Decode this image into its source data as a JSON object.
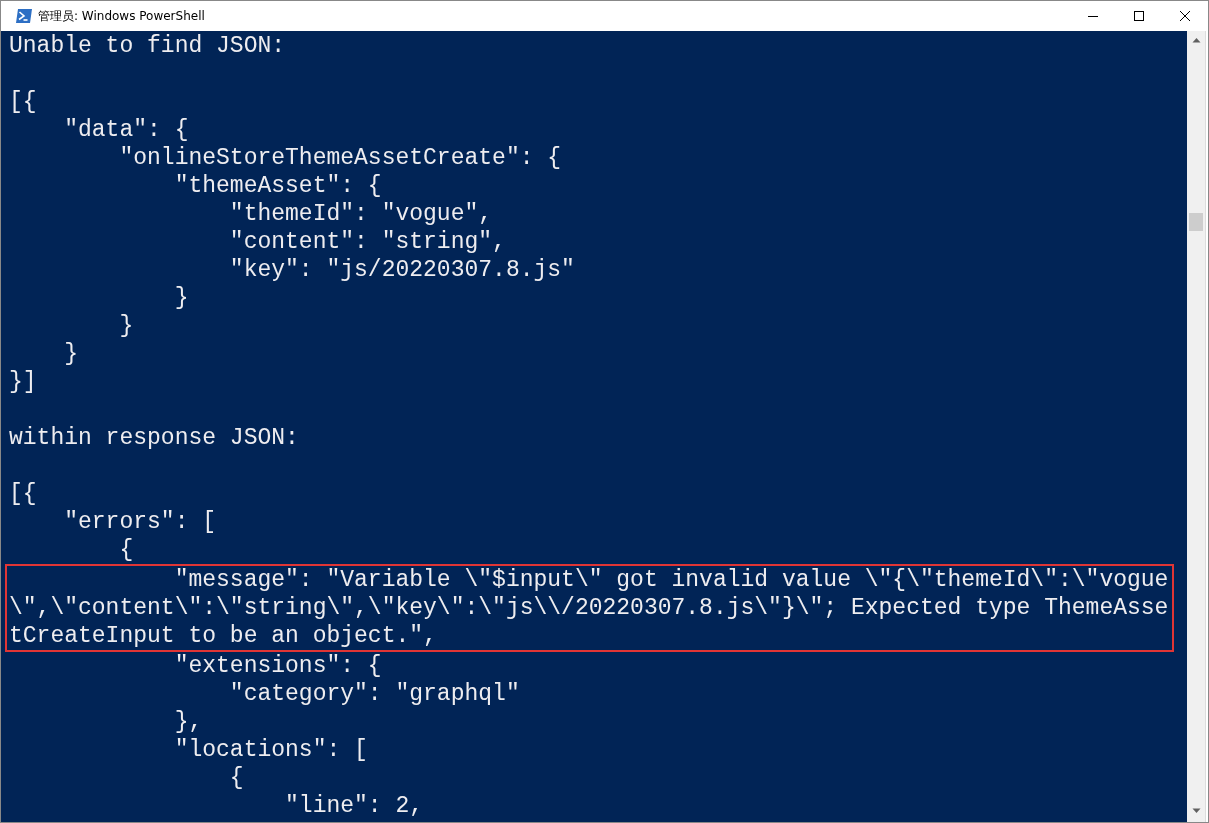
{
  "window": {
    "title": "管理员: Windows PowerShell"
  },
  "console": {
    "lines": [
      {
        "kind": "text",
        "text": "Unable to find JSON:"
      },
      {
        "kind": "blank"
      },
      {
        "kind": "text",
        "text": "[{"
      },
      {
        "kind": "text",
        "text": "    \"data\": {"
      },
      {
        "kind": "text",
        "text": "        \"onlineStoreThemeAssetCreate\": {"
      },
      {
        "kind": "text",
        "text": "            \"themeAsset\": {"
      },
      {
        "kind": "text",
        "text": "                \"themeId\": \"vogue\","
      },
      {
        "kind": "text",
        "text": "                \"content\": \"string\","
      },
      {
        "kind": "text",
        "text": "                \"key\": \"js/20220307.8.js\""
      },
      {
        "kind": "text",
        "text": "            }"
      },
      {
        "kind": "text",
        "text": "        }"
      },
      {
        "kind": "text",
        "text": "    }"
      },
      {
        "kind": "text",
        "text": "}]"
      },
      {
        "kind": "blank"
      },
      {
        "kind": "text",
        "text": "within response JSON:"
      },
      {
        "kind": "blank"
      },
      {
        "kind": "text",
        "text": "[{"
      },
      {
        "kind": "text",
        "text": "    \"errors\": ["
      },
      {
        "kind": "text",
        "text": "        {"
      },
      {
        "kind": "highlight",
        "lines": [
          "            \"message\": \"Variable \\\"$input\\\" got invalid value \\\"{\\\"themeId\\\":\\\"vogue",
          "\\\",\\\"content\\\":\\\"string\\\",\\\"key\\\":\\\"js\\\\/20220307.8.js\\\"}\\\"; Expected type ThemeAsse",
          "tCreateInput to be an object.\","
        ]
      },
      {
        "kind": "text",
        "text": "            \"extensions\": {"
      },
      {
        "kind": "text",
        "text": "                \"category\": \"graphql\""
      },
      {
        "kind": "text",
        "text": "            },"
      },
      {
        "kind": "text",
        "text": "            \"locations\": ["
      },
      {
        "kind": "text",
        "text": "                {"
      },
      {
        "kind": "text",
        "text": "                    \"line\": 2,"
      }
    ]
  }
}
